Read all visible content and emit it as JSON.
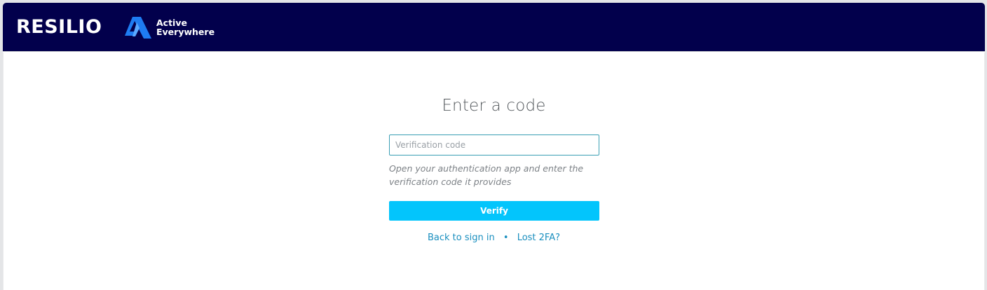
{
  "header": {
    "brand_name": "RESILIO",
    "product_line1": "Active",
    "product_line2": "Everywhere",
    "logo_icon": "active-everywhere-logo-icon",
    "bar_color": "#02004c",
    "logo_color": "#1e7cf2"
  },
  "form": {
    "title": "Enter a code",
    "code_placeholder": "Verification code",
    "code_value": "",
    "hint": "Open your authentication app and enter the verification code it provides",
    "verify_label": "Verify",
    "verify_color": "#03c5fc"
  },
  "links": {
    "back_label": "Back to sign in",
    "separator": "•",
    "lost_label": "Lost 2FA?",
    "link_color": "#1a8fbf"
  }
}
